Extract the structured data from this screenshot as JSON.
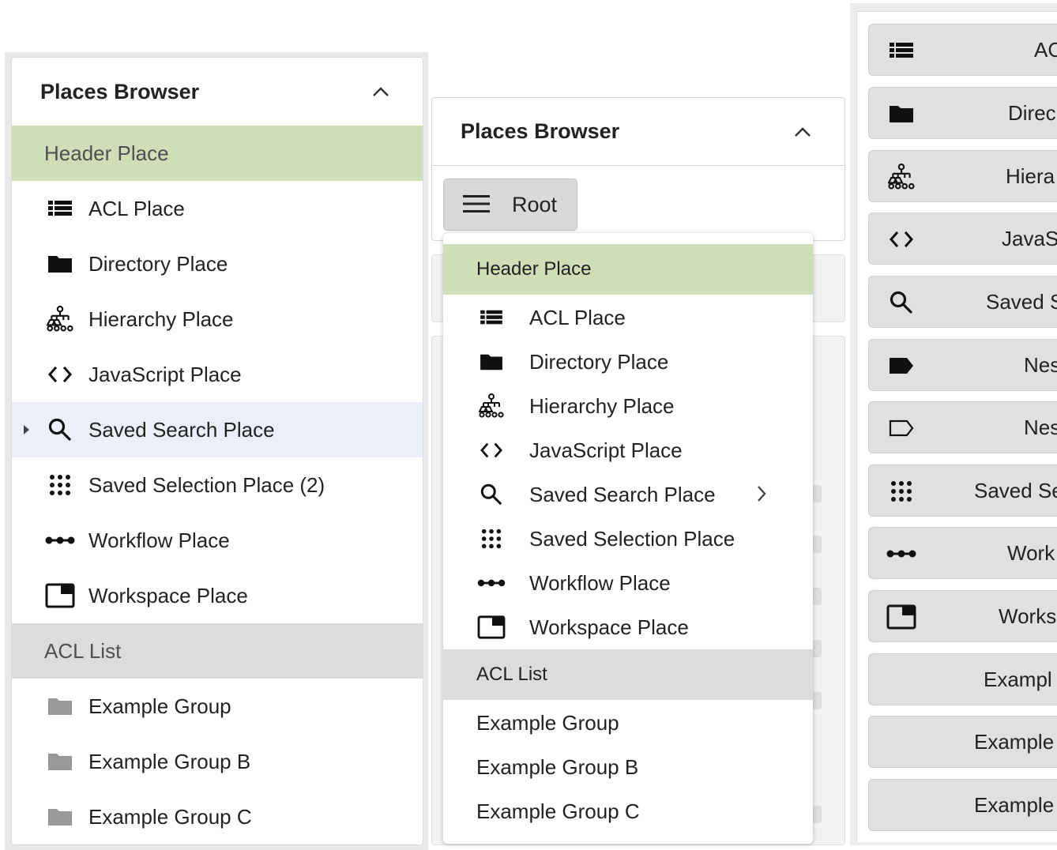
{
  "panel1": {
    "title": "Places Browser",
    "header_place": "Header Place",
    "places": [
      {
        "label": "ACL Place",
        "icon": "list-icon"
      },
      {
        "label": "Directory Place",
        "icon": "folder-icon"
      },
      {
        "label": "Hierarchy Place",
        "icon": "hierarchy-icon"
      },
      {
        "label": "JavaScript Place",
        "icon": "code-icon"
      },
      {
        "label": "Saved Search Place",
        "icon": "search-icon"
      },
      {
        "label": "Saved Selection Place (2)",
        "icon": "grid-dots-icon"
      },
      {
        "label": "Workflow Place",
        "icon": "workflow-icon"
      },
      {
        "label": "Workspace Place",
        "icon": "workspace-icon"
      }
    ],
    "acl_list": "ACL List",
    "groups": [
      "Example Group",
      "Example Group B",
      "Example Group C"
    ]
  },
  "panel2": {
    "title": "Places Browser",
    "root_label": "Root",
    "dropdown": {
      "header_place": "Header Place",
      "places": [
        {
          "label": "ACL Place",
          "icon": "list-icon"
        },
        {
          "label": "Directory Place",
          "icon": "folder-icon"
        },
        {
          "label": "Hierarchy Place",
          "icon": "hierarchy-icon"
        },
        {
          "label": "JavaScript Place",
          "icon": "code-icon"
        },
        {
          "label": "Saved Search Place",
          "icon": "search-icon"
        },
        {
          "label": "Saved Selection Place",
          "icon": "grid-dots-icon"
        },
        {
          "label": "Workflow Place",
          "icon": "workflow-icon"
        },
        {
          "label": "Workspace Place",
          "icon": "workspace-icon"
        }
      ],
      "acl_list": "ACL List",
      "groups": [
        "Example Group",
        "Example Group B",
        "Example Group C"
      ]
    }
  },
  "panel3": {
    "buttons": [
      {
        "label": "AC",
        "icon": "list-icon"
      },
      {
        "label": "Direc",
        "icon": "folder-icon"
      },
      {
        "label": "Hiera",
        "icon": "hierarchy-icon"
      },
      {
        "label": "JavaS",
        "icon": "code-icon"
      },
      {
        "label": "Saved S",
        "icon": "search-icon"
      },
      {
        "label": "Nes",
        "icon": "tag-filled-icon"
      },
      {
        "label": "Nes",
        "icon": "tag-outline-icon"
      },
      {
        "label": "Saved Se",
        "icon": "grid-dots-icon"
      },
      {
        "label": "Work",
        "icon": "workflow-icon"
      },
      {
        "label": "Works",
        "icon": "workspace-icon"
      },
      {
        "label": "Exampl",
        "icon": ""
      },
      {
        "label": "Example",
        "icon": ""
      },
      {
        "label": "Example",
        "icon": ""
      }
    ]
  },
  "colors": {
    "header_place_bg": "#cfddb8",
    "acl_list_bg": "#dcdcdc",
    "selected_row_bg": "#eaeffa",
    "group_folder": "#999999"
  }
}
